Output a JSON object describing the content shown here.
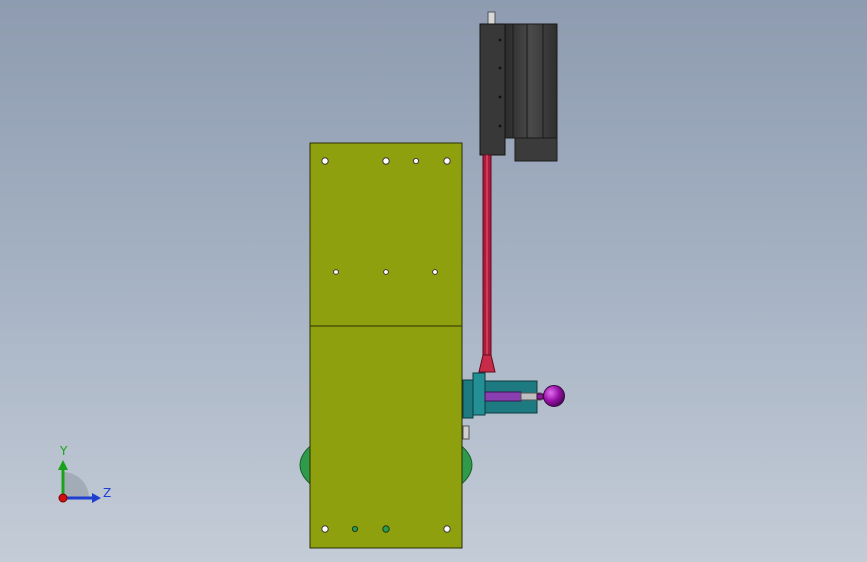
{
  "viewport": {
    "background_top": "#8e9bb0",
    "background_bottom": "#c4ccd7"
  },
  "model": {
    "plate_color": "#8fa00e",
    "wheel_color": "#2e9a4a",
    "actuator_color": "#3a3a3a",
    "rod_color": "#b01a3a",
    "bracket_color": "#1d7a80",
    "knob_color": "#9a12a8"
  },
  "triad": {
    "y_axis_label": "Y",
    "z_axis_label": "Z",
    "y_color": "#1aa31a",
    "z_color": "#1f3fd0",
    "x_color": "#d01010",
    "icons": [
      "triad-y-arrow-icon",
      "triad-z-arrow-icon",
      "triad-origin-icon"
    ]
  }
}
